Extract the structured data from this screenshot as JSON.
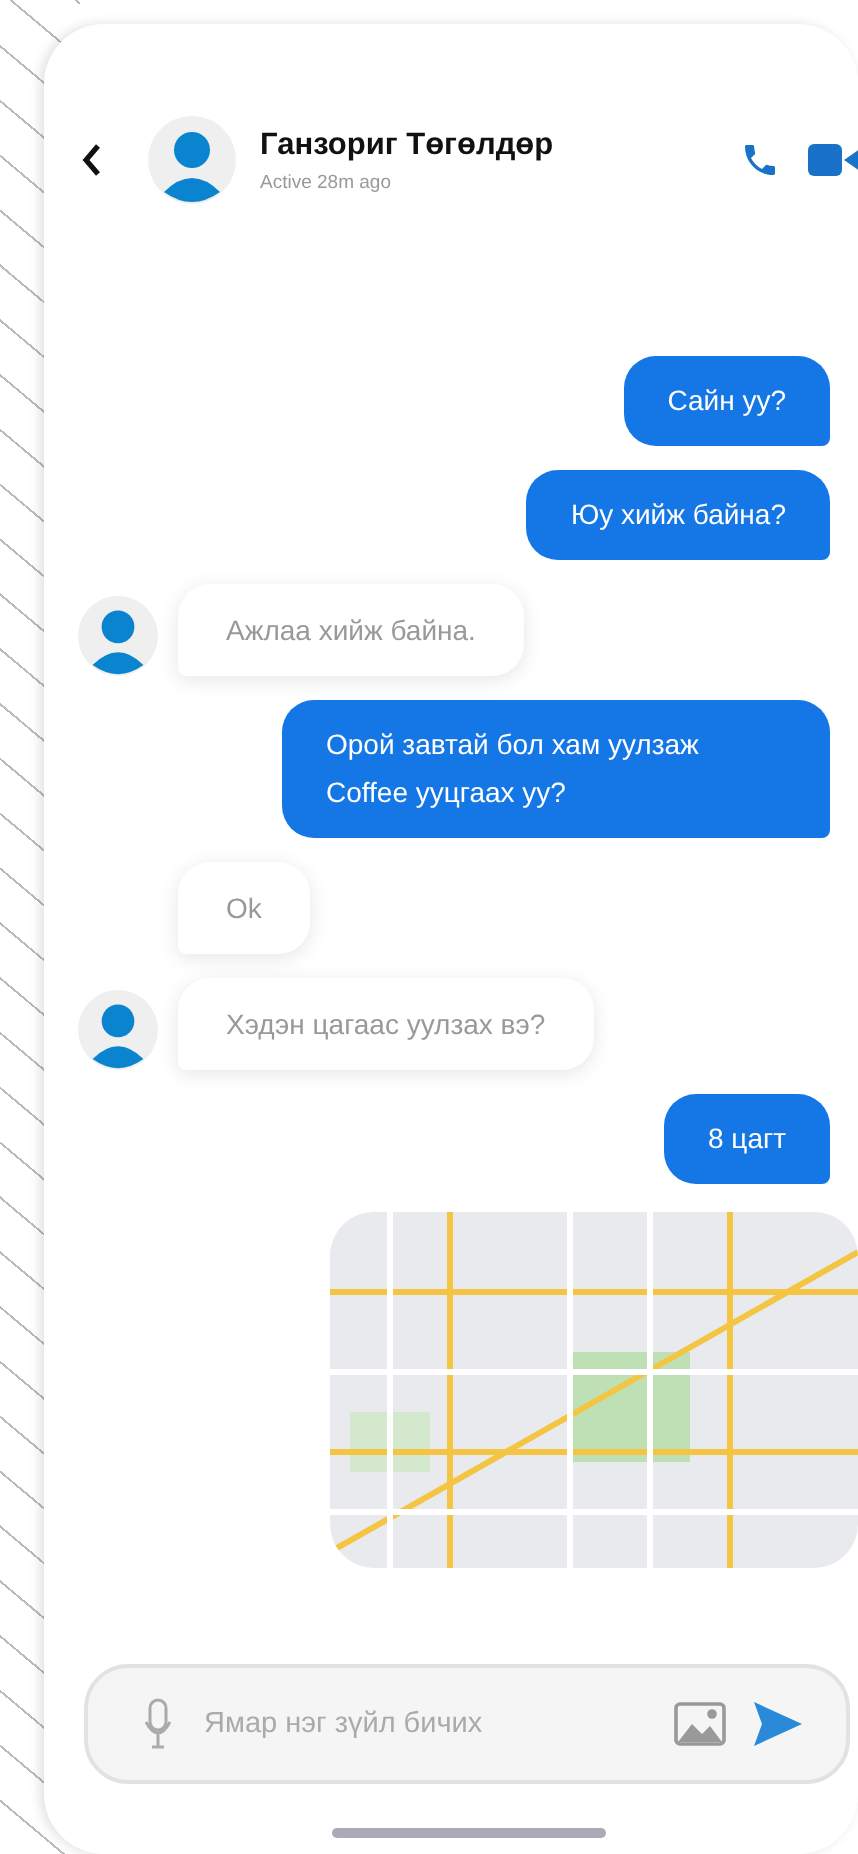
{
  "header": {
    "name": "Ганзориг Төгөлдөр",
    "status": "Active 28m ago"
  },
  "messages": [
    {
      "kind": "sent",
      "text": "Сайн уу?"
    },
    {
      "kind": "sent",
      "text": "Юу хийж байна?"
    },
    {
      "kind": "received",
      "avatar": true,
      "text": "Ажлаа хийж байна."
    },
    {
      "kind": "sent",
      "text": "Орой завтай бол хам уулзаж Coffee ууцгаах уу?"
    },
    {
      "kind": "received",
      "avatar": false,
      "text": "Ok"
    },
    {
      "kind": "received",
      "avatar": true,
      "text": "Хэдэн цагаас уулзах вэ?"
    },
    {
      "kind": "sent",
      "text": "8 цагт"
    },
    {
      "kind": "map"
    }
  ],
  "composer": {
    "placeholder": "Ямар нэг зүйл бичих"
  }
}
